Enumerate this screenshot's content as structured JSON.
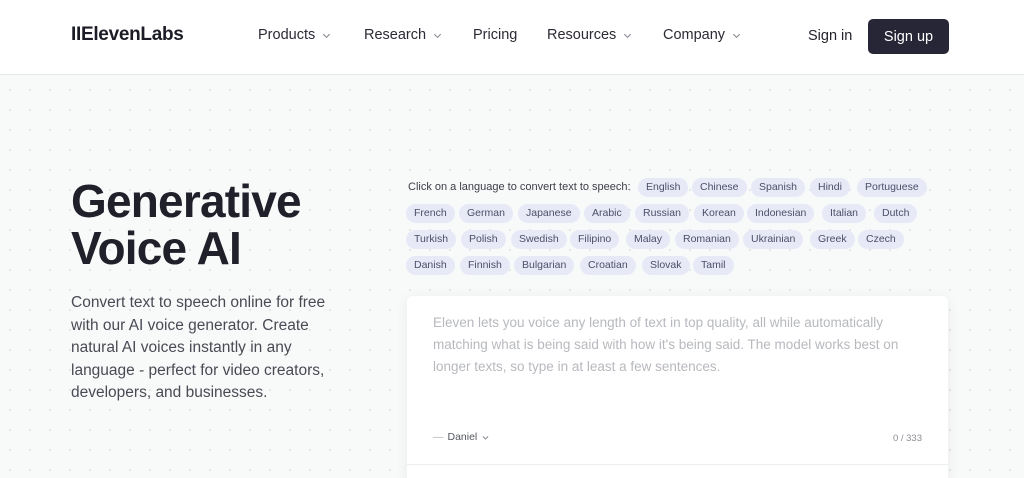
{
  "header": {
    "logo": "IIElevenLabs",
    "nav": [
      {
        "label": "Products",
        "has_dropdown": true
      },
      {
        "label": "Research",
        "has_dropdown": true
      },
      {
        "label": "Pricing",
        "has_dropdown": false
      },
      {
        "label": "Resources",
        "has_dropdown": true
      },
      {
        "label": "Company",
        "has_dropdown": true
      }
    ],
    "sign_in": "Sign in",
    "sign_up": "Sign up"
  },
  "hero": {
    "title": "Generative Voice AI",
    "description": "Convert text to speech online for free with our AI voice generator. Create natural AI voices instantly in any language - perfect for video creators, developers, and businesses."
  },
  "languages": {
    "prompt": "Click on a language to convert text to speech:",
    "items": [
      "English",
      "Chinese",
      "Spanish",
      "Hindi",
      "Portuguese",
      "French",
      "German",
      "Japanese",
      "Arabic",
      "Russian",
      "Korean",
      "Indonesian",
      "Italian",
      "Dutch",
      "Turkish",
      "Polish",
      "Swedish",
      "Filipino",
      "Malay",
      "Romanian",
      "Ukrainian",
      "Greek",
      "Czech",
      "Danish",
      "Finnish",
      "Bulgarian",
      "Croatian",
      "Slovak",
      "Tamil"
    ]
  },
  "tts": {
    "text": "Eleven lets you voice any length of text in top quality, all while automatically matching what is being said with how it's being said. The model works best on longer texts, so type in at least a few sentences.",
    "voice": "Daniel",
    "counter": "0 / 333"
  },
  "colors": {
    "accent_dark": "#262636",
    "chip_bg": "#e8e9f7",
    "chip_text": "#4b4e68"
  }
}
